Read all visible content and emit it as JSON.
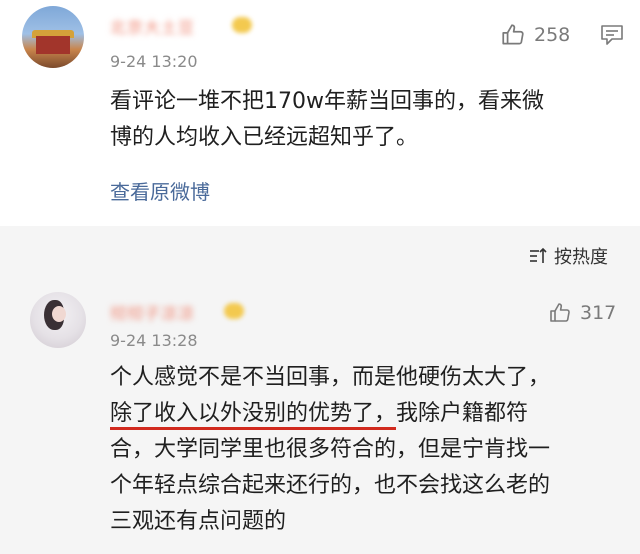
{
  "comment1": {
    "username": "北京大土豆",
    "time": "9-24 13:20",
    "likes": "258",
    "lines": [
      "看评论一堆不把170w年薪当回事的，看来微",
      "博的人均收入已经远超知乎了。"
    ],
    "view_original": "查看原微博"
  },
  "sort": {
    "label": "按热度"
  },
  "comment2": {
    "username": "彻彻子凉凉",
    "time": "9-24 13:28",
    "likes": "317",
    "line1": "个人感觉不是不当回事，而是他硬伤太大了，",
    "line2_underlined": "除了收入以外没别的优势了，",
    "line2_rest": "我除户籍都符",
    "line3": "合，大学同学里也很多符合的，但是宁肯找一",
    "line4": "个年轻点综合起来还行的，也不会找这么老的",
    "line5": "三观还有点问题的"
  },
  "colors": {
    "link": "#4a6a9a",
    "underline": "#d12a1e",
    "time": "#8a8a8a"
  },
  "icons": [
    "thumbs-up-icon",
    "comment-icon",
    "sort-icon"
  ]
}
